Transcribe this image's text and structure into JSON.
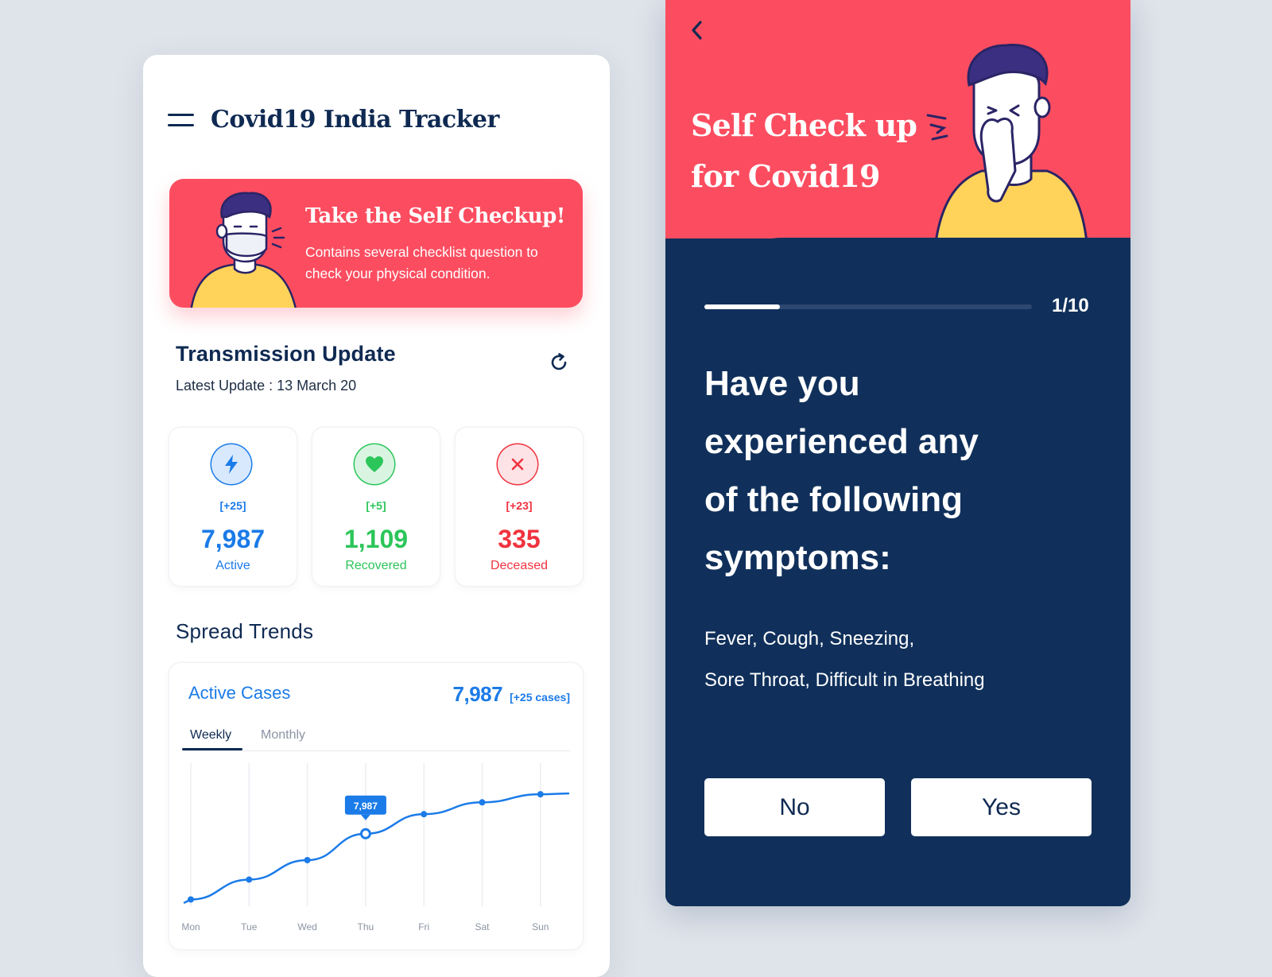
{
  "app": {
    "title": "Covid19 India Tracker"
  },
  "banner": {
    "title": "Take the Self Checkup!",
    "description": "Contains several checklist question to check your physical condition."
  },
  "transmission": {
    "title": "Transmission Update",
    "latest_update": "Latest Update : 13 March 20",
    "stats": [
      {
        "delta": "[+25]",
        "value": "7,987",
        "label": "Active",
        "color": "#1b7be8",
        "icon": "bolt-icon"
      },
      {
        "delta": "[+5]",
        "value": "1,109",
        "label": "Recovered",
        "color": "#2cc55a",
        "icon": "heart-icon"
      },
      {
        "delta": "[+23]",
        "value": "335",
        "label": "Deceased",
        "color": "#f0333f",
        "icon": "close-icon"
      }
    ]
  },
  "trends": {
    "title": "Spread Trends",
    "card_title": "Active Cases",
    "total_value": "7,987",
    "total_note": "[+25 cases]",
    "tabs": [
      "Weekly",
      "Monthly"
    ],
    "active_tab": "Weekly"
  },
  "chart_data": {
    "type": "line",
    "categories": [
      "Mon",
      "Tue",
      "Wed",
      "Thu",
      "Fri",
      "Sat",
      "Sun"
    ],
    "series": [
      {
        "values": [
          1050,
          3150,
          5200,
          7987,
          10050,
          11300,
          12150
        ]
      }
    ],
    "ylim": [
      0,
      13000
    ],
    "highlight": {
      "category": "Thu",
      "label": "7,987"
    },
    "grid": "vertical",
    "accent": "#1b7be8"
  },
  "selfcheck": {
    "title_line1": "Self Check up",
    "title_line2": "for Covid19",
    "progress_text": "1/10",
    "progress_fraction": 0.1,
    "question_lines": [
      "Have you",
      "experienced any",
      "of the following",
      "symptoms:"
    ],
    "symptoms_lines": [
      "Fever, Cough, Sneezing,",
      "Sore Throat, Difficult in Breathing"
    ],
    "no_label": "No",
    "yes_label": "Yes"
  },
  "colors": {
    "navy": "#0f2a52",
    "coral": "#fc4d60",
    "blue": "#1b7be8",
    "green": "#2cc55a",
    "red": "#f0333f"
  }
}
